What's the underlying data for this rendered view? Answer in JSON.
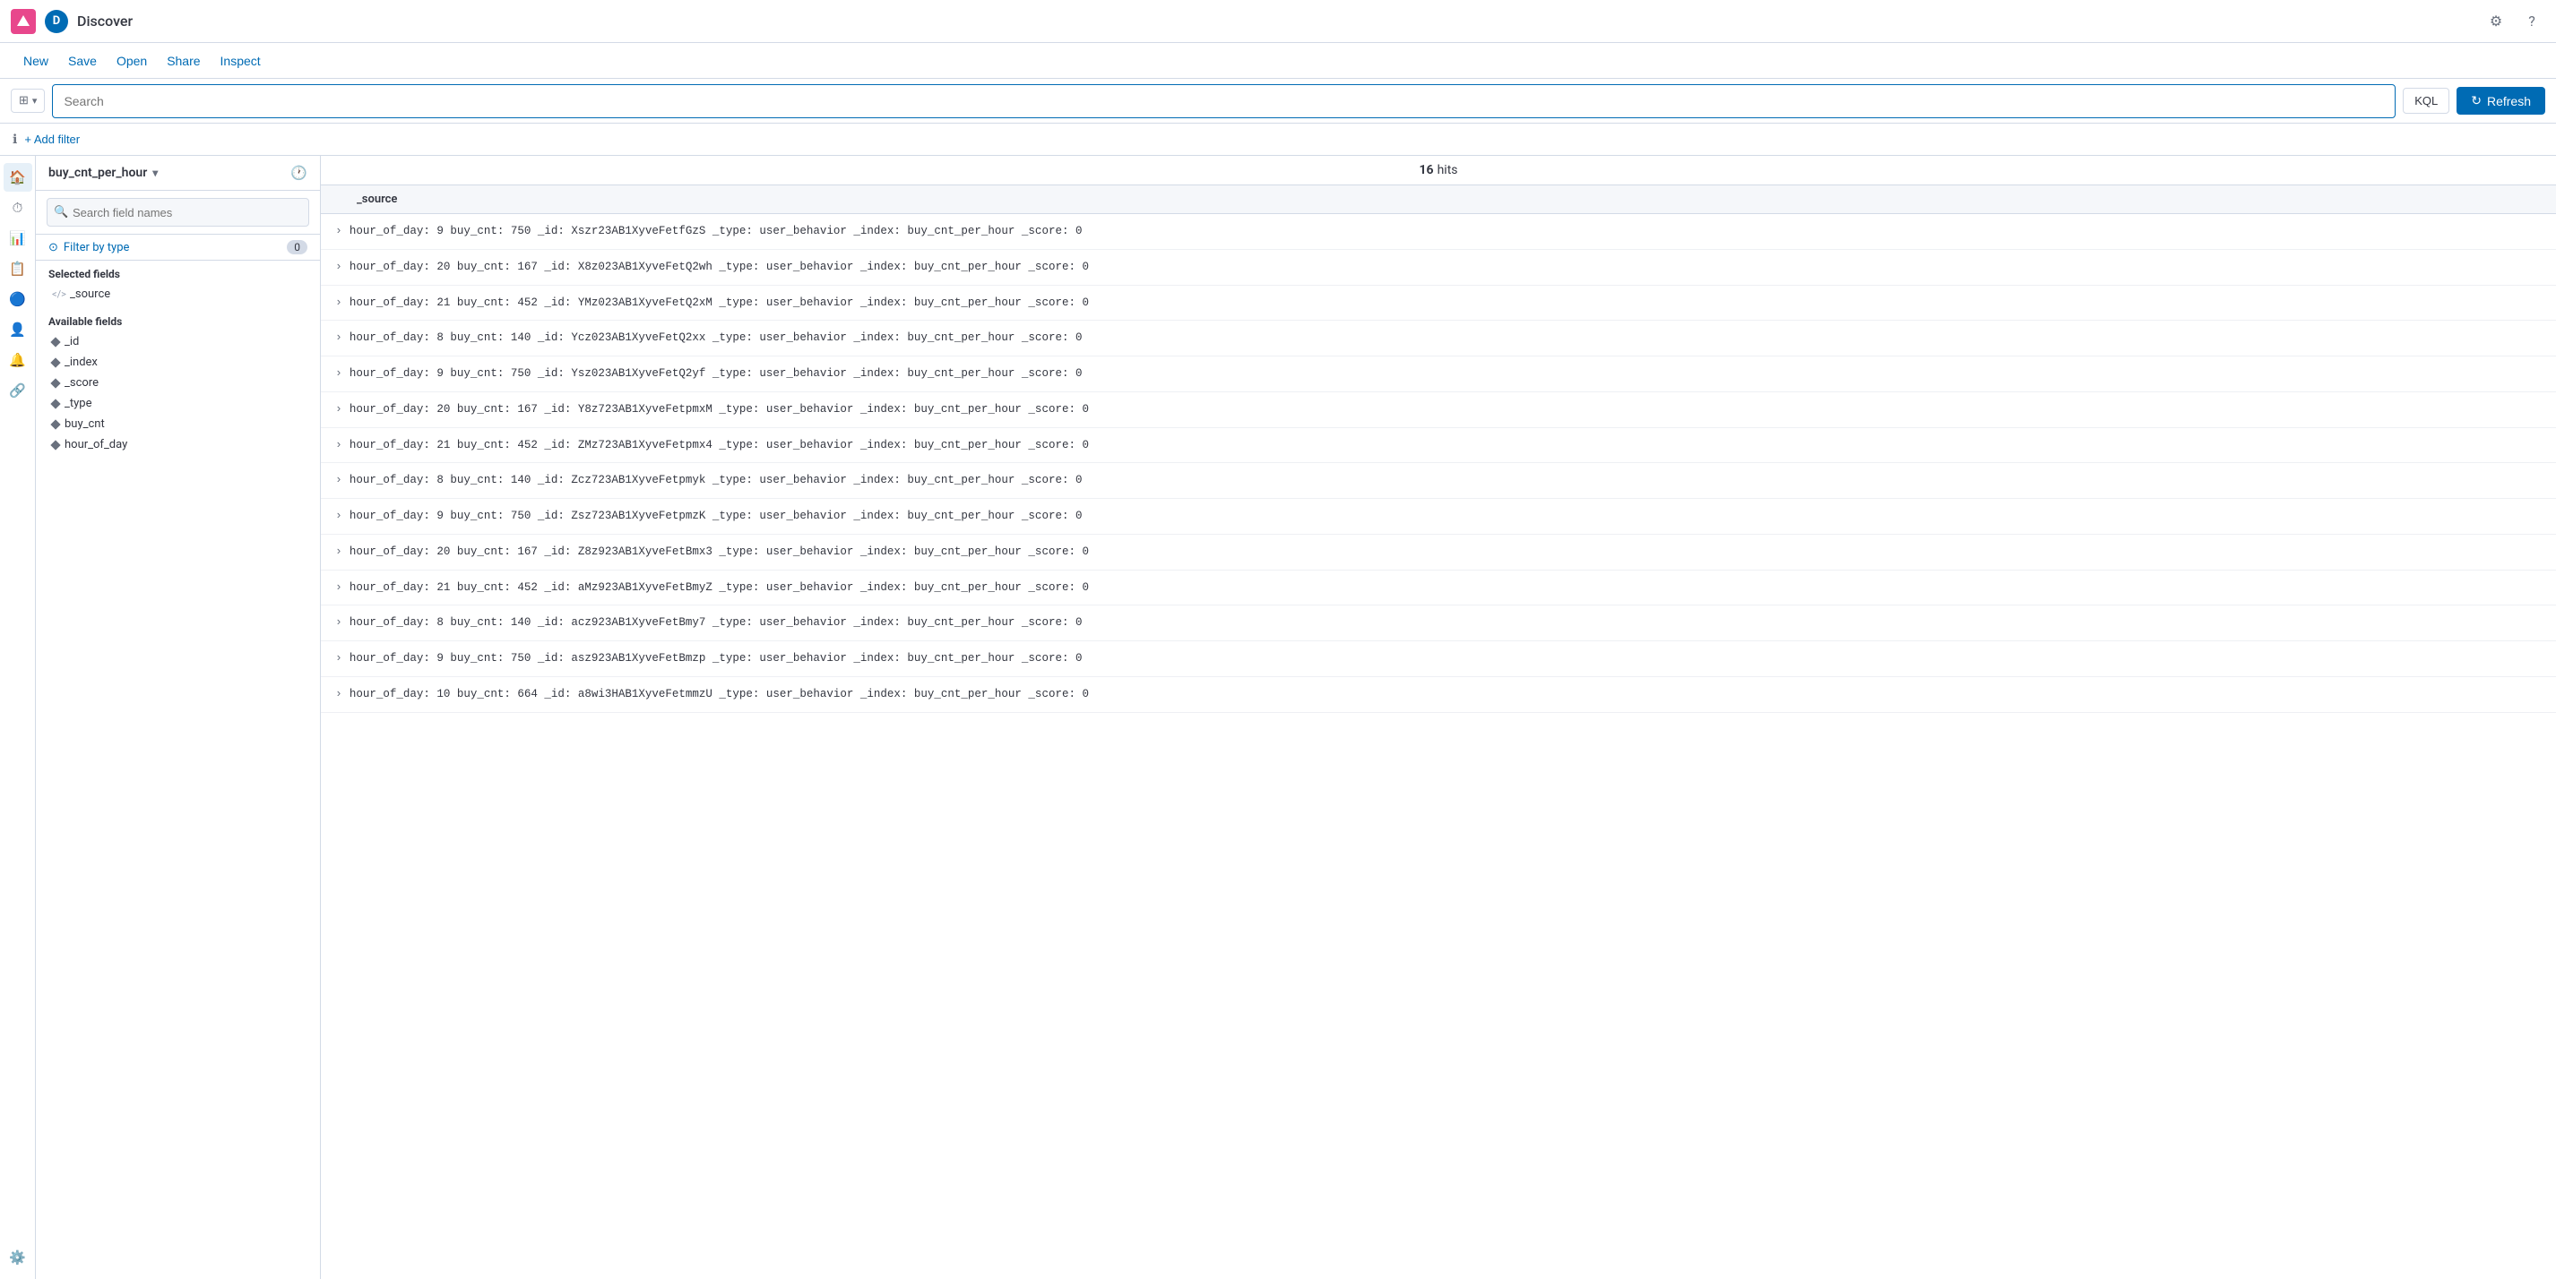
{
  "app": {
    "logo_letter": "D",
    "title": "Discover"
  },
  "topbar": {
    "new_label": "New",
    "save_label": "Save",
    "open_label": "Open",
    "share_label": "Share",
    "inspect_label": "Inspect"
  },
  "searchbar": {
    "placeholder": "Search",
    "kql_label": "KQL",
    "refresh_label": "Refresh"
  },
  "filter": {
    "add_filter_label": "+ Add filter"
  },
  "sidebar": {
    "index_name": "buy_cnt_per_hour",
    "search_placeholder": "Search field names",
    "filter_by_type": "Filter by type",
    "filter_count": "0",
    "selected_fields_title": "Selected fields",
    "available_fields_title": "Available fields",
    "selected_fields": [
      {
        "name": "_source",
        "icon": "<>"
      }
    ],
    "available_fields": [
      {
        "name": "_id",
        "icon": "#"
      },
      {
        "name": "_index",
        "icon": "#"
      },
      {
        "name": "_score",
        "icon": "#"
      },
      {
        "name": "_type",
        "icon": "#"
      },
      {
        "name": "buy_cnt",
        "icon": "#"
      },
      {
        "name": "hour_of_day",
        "icon": "#"
      }
    ]
  },
  "results": {
    "hits_count": "16",
    "hits_label": "hits",
    "source_header": "_source",
    "rows": [
      "hour_of_day: 9  buy_cnt: 750  _id: Xszr23AB1XyveFetfGzS  _type: user_behavior  _index: buy_cnt_per_hour  _score: 0",
      "hour_of_day: 20  buy_cnt: 167  _id: X8z023AB1XyveFetQ2wh  _type: user_behavior  _index: buy_cnt_per_hour  _score: 0",
      "hour_of_day: 21  buy_cnt: 452  _id: YMz023AB1XyveFetQ2xM  _type: user_behavior  _index: buy_cnt_per_hour  _score: 0",
      "hour_of_day: 8  buy_cnt: 140  _id: Ycz023AB1XyveFetQ2xx  _type: user_behavior  _index: buy_cnt_per_hour  _score: 0",
      "hour_of_day: 9  buy_cnt: 750  _id: Ysz023AB1XyveFetQ2yf  _type: user_behavior  _index: buy_cnt_per_hour  _score: 0",
      "hour_of_day: 20  buy_cnt: 167  _id: Y8z723AB1XyveFetpmxM  _type: user_behavior  _index: buy_cnt_per_hour  _score: 0",
      "hour_of_day: 21  buy_cnt: 452  _id: ZMz723AB1XyveFetpmx4  _type: user_behavior  _index: buy_cnt_per_hour  _score: 0",
      "hour_of_day: 8  buy_cnt: 140  _id: Zcz723AB1XyveFetpmyk  _type: user_behavior  _index: buy_cnt_per_hour  _score: 0",
      "hour_of_day: 9  buy_cnt: 750  _id: Zsz723AB1XyveFetpmzK  _type: user_behavior  _index: buy_cnt_per_hour  _score: 0",
      "hour_of_day: 20  buy_cnt: 167  _id: Z8z923AB1XyveFetBmx3  _type: user_behavior  _index: buy_cnt_per_hour  _score: 0",
      "hour_of_day: 21  buy_cnt: 452  _id: aMz923AB1XyveFetBmyZ  _type: user_behavior  _index: buy_cnt_per_hour  _score: 0",
      "hour_of_day: 8  buy_cnt: 140  _id: acz923AB1XyveFetBmy7  _type: user_behavior  _index: buy_cnt_per_hour  _score: 0",
      "hour_of_day: 9  buy_cnt: 750  _id: asz923AB1XyveFetBmzp  _type: user_behavior  _index: buy_cnt_per_hour  _score: 0",
      "hour_of_day: 10  buy_cnt: 664  _id: a8wi3HAB1XyveFetmmzU  _type: user_behavior  _index: buy_cnt_per_hour  _score: 0"
    ]
  },
  "left_nav": {
    "icons": [
      "🏠",
      "⏱",
      "📊",
      "📋",
      "🔵",
      "👤",
      "🔔",
      "🔗",
      "⚙️"
    ]
  }
}
